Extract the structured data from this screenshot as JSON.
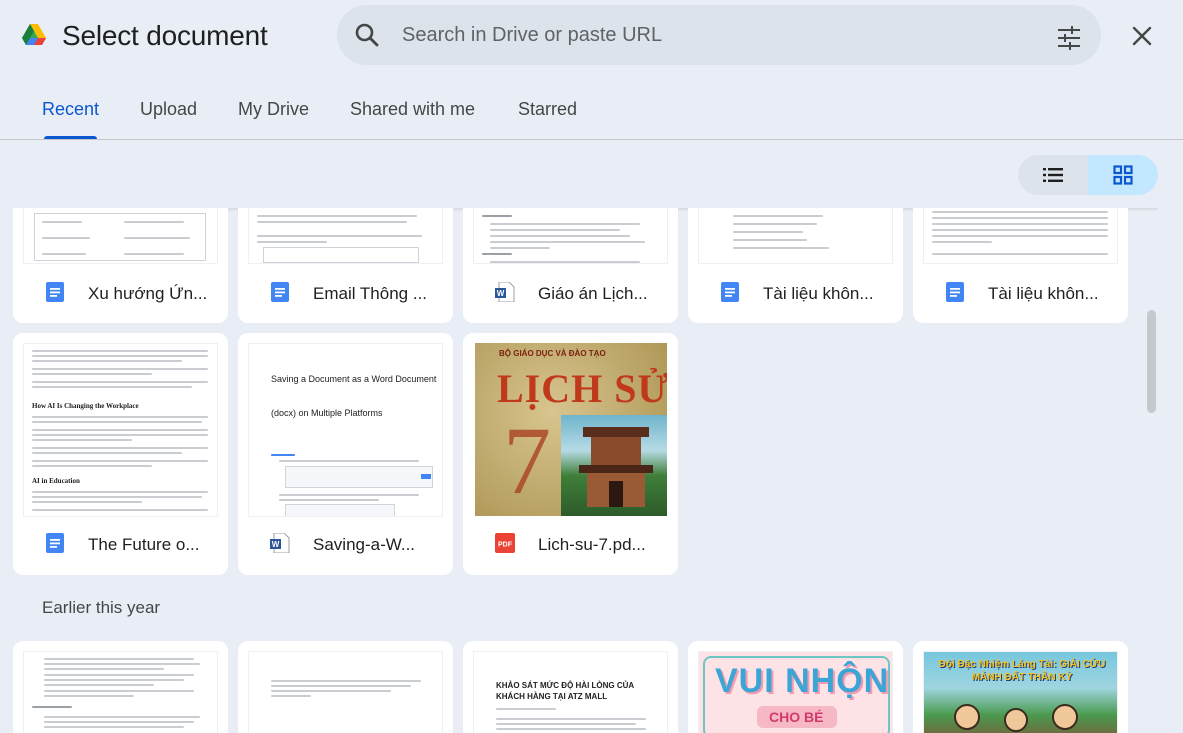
{
  "header": {
    "title": "Select document",
    "search_placeholder": "Search in Drive or paste URL"
  },
  "tabs": [
    {
      "label": "Recent",
      "active": true
    },
    {
      "label": "Upload",
      "active": false
    },
    {
      "label": "My Drive",
      "active": false
    },
    {
      "label": "Shared with me",
      "active": false
    },
    {
      "label": "Starred",
      "active": false
    }
  ],
  "view_toggle": {
    "selected": "grid"
  },
  "recent_files": [
    {
      "name": "Xu hướng Ứn...",
      "type": "google-docs"
    },
    {
      "name": "Email Thông ...",
      "type": "google-docs"
    },
    {
      "name": "Giáo án Lịch...",
      "type": "word"
    },
    {
      "name": "Tài liệu khôn...",
      "type": "google-docs"
    },
    {
      "name": "Tài liệu khôn...",
      "type": "google-docs"
    },
    {
      "name": "The Future o...",
      "type": "google-docs"
    },
    {
      "name": "Saving-a-W...",
      "type": "word"
    },
    {
      "name": "Lich-su-7.pd...",
      "type": "pdf"
    }
  ],
  "thumb_text": {
    "saving_line1": "Saving a Document as a Word Document",
    "saving_line2": "(docx) on Multiple Platforms",
    "future_h1": "How AI Is Changing the Workplace",
    "future_h2": "AI in Education",
    "book_publisher": "BỘ GIÁO DỤC VÀ ĐÀO TẠO",
    "book_title": "LỊCH SỬ",
    "book_grade": "7",
    "survey_title": "KHẢO SÁT MỨC ĐỘ HÀI LÒNG CỦA KHÁCH HÀNG TẠI ATZ MALL",
    "vui_title": "VUI NHỘN",
    "vui_sub": "CHO BÉ",
    "comic_title": "Đội Đặc Nhiệm Láng Tài: GIẢI CỨU MẢNH ĐẤT THẦN KỲ"
  },
  "sections": {
    "earlier": "Earlier this year"
  },
  "colors": {
    "accent": "#0b57d0",
    "docs_blue": "#4285f4",
    "pdf_red": "#ea4335",
    "word_blue": "#2b579a",
    "grid_toggle_bg": "#c2e7ff"
  }
}
